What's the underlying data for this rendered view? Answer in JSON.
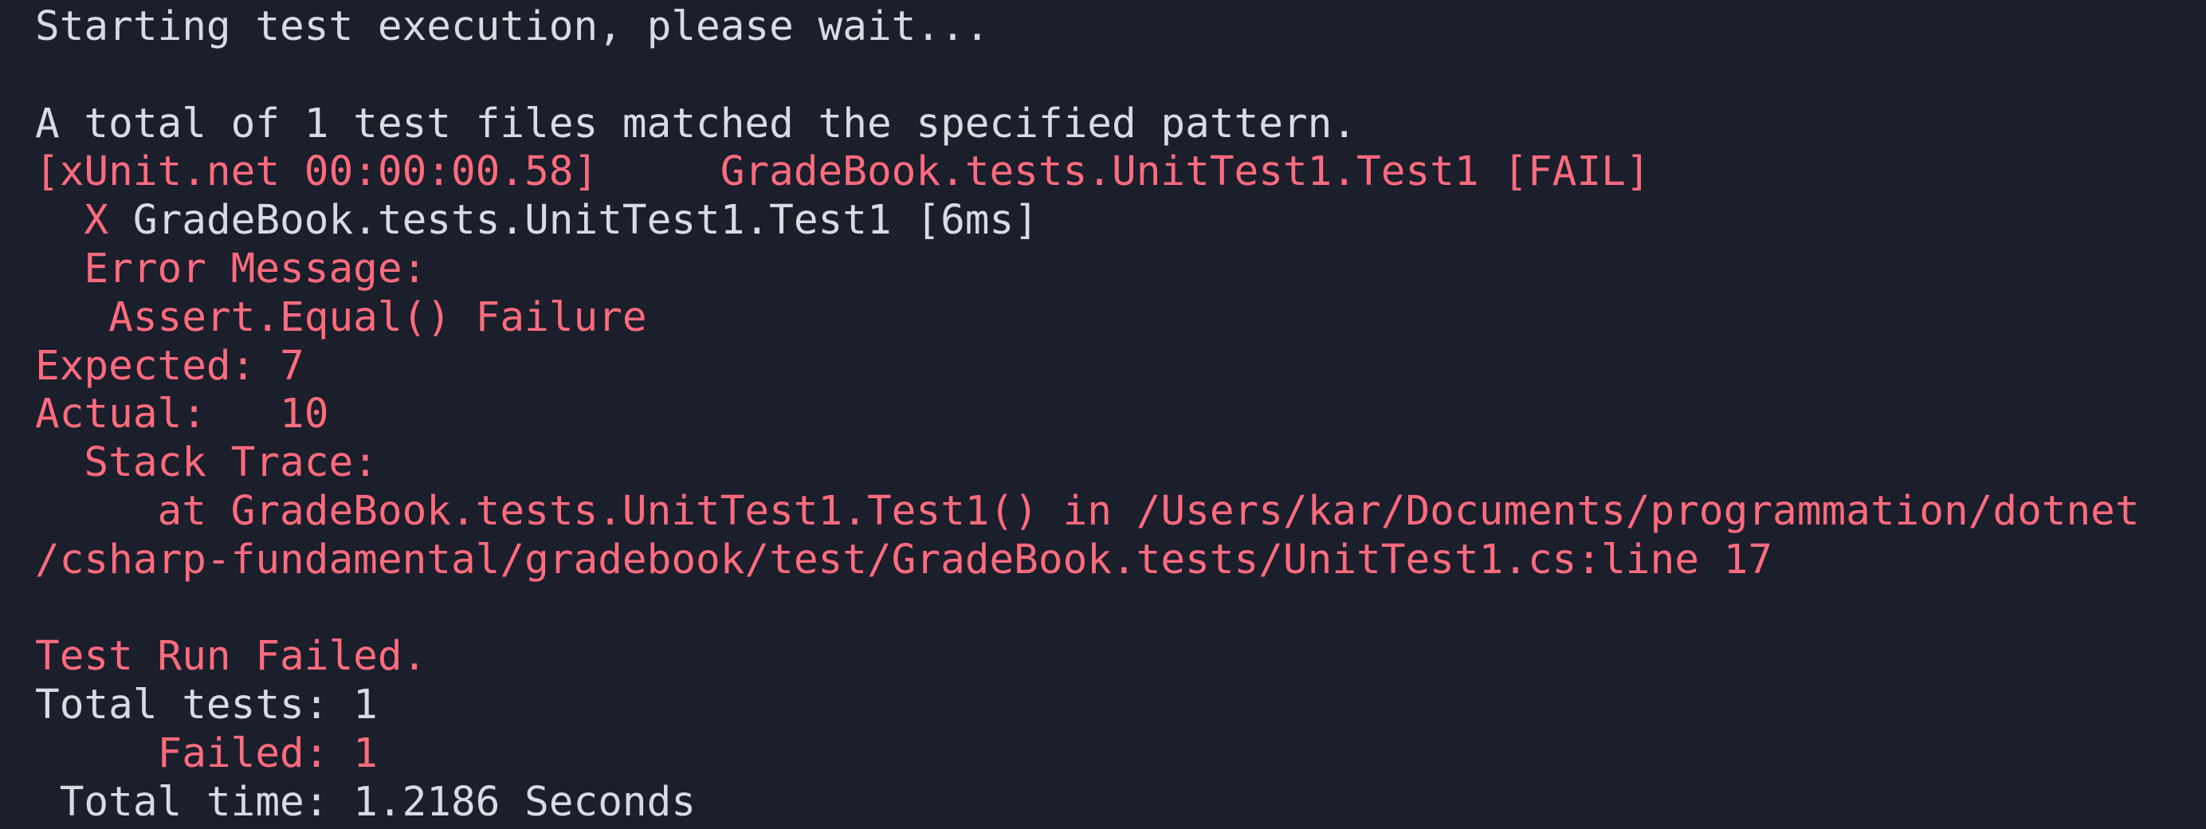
{
  "terminal": {
    "lines": [
      {
        "segments": [
          {
            "text": "Starting test execution, please wait...",
            "color": "#d9dbe3"
          }
        ]
      },
      {
        "segments": [
          {
            "text": "",
            "color": "#d9dbe3"
          }
        ]
      },
      {
        "segments": [
          {
            "text": "A total of 1 test files matched the specified pattern.",
            "color": "#d9dbe3"
          }
        ]
      },
      {
        "segments": [
          {
            "text": "[xUnit.net 00:00:00.58]     GradeBook.tests.UnitTest1.Test1 [FAIL]",
            "color": "#ff6b7d"
          }
        ]
      },
      {
        "segments": [
          {
            "text": "  X ",
            "color": "#ff6b7d"
          },
          {
            "text": "GradeBook.tests.UnitTest1.Test1 [6ms]",
            "color": "#d9dbe3"
          }
        ]
      },
      {
        "segments": [
          {
            "text": "  Error Message:",
            "color": "#ff6b7d"
          }
        ]
      },
      {
        "segments": [
          {
            "text": "   Assert.Equal() Failure",
            "color": "#ff6b7d"
          }
        ]
      },
      {
        "segments": [
          {
            "text": "Expected: 7",
            "color": "#ff6b7d"
          }
        ]
      },
      {
        "segments": [
          {
            "text": "Actual:   10",
            "color": "#ff6b7d"
          }
        ]
      },
      {
        "segments": [
          {
            "text": "  Stack Trace:",
            "color": "#ff6b7d"
          }
        ]
      },
      {
        "segments": [
          {
            "text": "     at GradeBook.tests.UnitTest1.Test1() in /Users/kar/Documents/programmation/dotnet",
            "color": "#ff6b7d"
          }
        ]
      },
      {
        "segments": [
          {
            "text": "/csharp-fundamental/gradebook/test/GradeBook.tests/UnitTest1.cs:line 17",
            "color": "#ff6b7d"
          }
        ]
      },
      {
        "segments": [
          {
            "text": "",
            "color": "#d9dbe3"
          }
        ]
      },
      {
        "segments": [
          {
            "text": "Test Run Failed.",
            "color": "#ff6b7d"
          }
        ]
      },
      {
        "segments": [
          {
            "text": "Total tests: 1",
            "color": "#d9dbe3"
          }
        ]
      },
      {
        "segments": [
          {
            "text": "     Failed: 1",
            "color": "#ff6b7d"
          }
        ]
      },
      {
        "segments": [
          {
            "text": " Total time: 1.2186 Seconds",
            "color": "#d9dbe3"
          }
        ]
      }
    ]
  },
  "colors": {
    "background": "#1b1e2b",
    "default_text": "#d9dbe3",
    "error_text": "#ff6b7d"
  }
}
